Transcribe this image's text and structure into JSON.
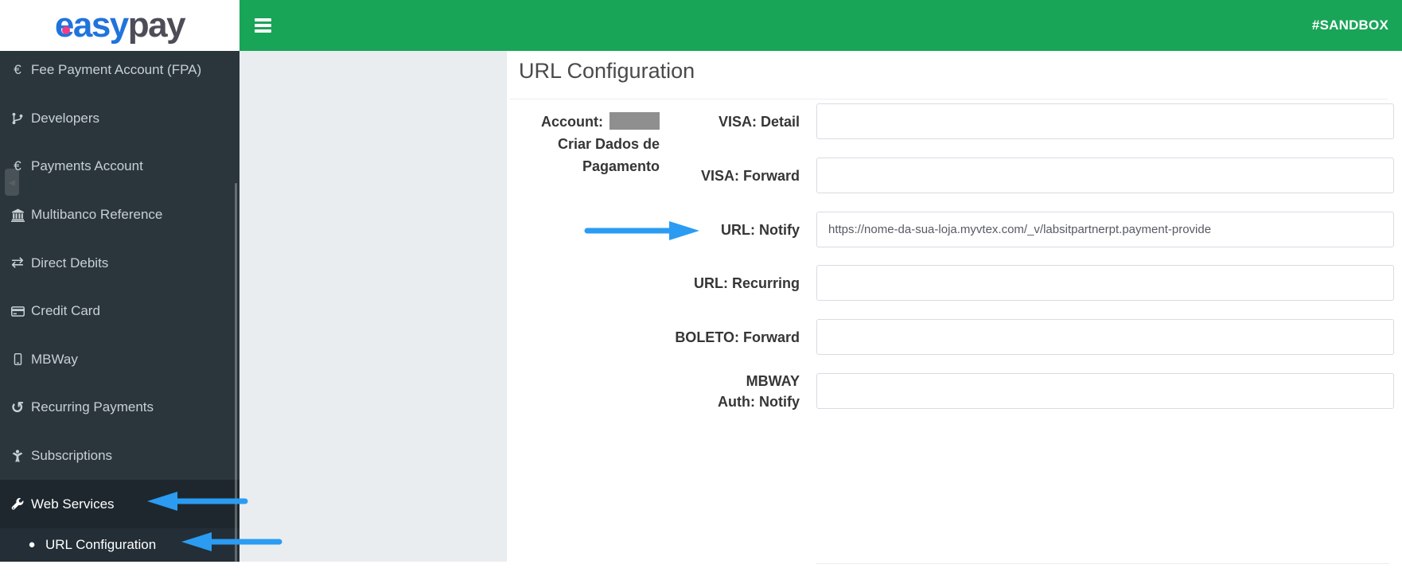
{
  "header": {
    "logo": {
      "text_primary": "easy",
      "text_secondary": "pay"
    },
    "sandbox_label": "#SANDBOX"
  },
  "icons": {
    "euro": "€",
    "exchange": "⇄",
    "history": "↺",
    "circle": "●",
    "triangle_left": "◀"
  },
  "sidebar": {
    "items": [
      {
        "icon": "euro-icon",
        "label": "Fee Payment Account (FPA)"
      },
      {
        "icon": "code-branch-icon",
        "label": "Developers"
      },
      {
        "icon": "euro-icon",
        "label": "Payments Account"
      },
      {
        "icon": "bank-icon",
        "label": "Multibanco Reference"
      },
      {
        "icon": "exchange-icon",
        "label": "Direct Debits"
      },
      {
        "icon": "credit-card-icon",
        "label": "Credit Card"
      },
      {
        "icon": "mobile-icon",
        "label": "MBWay"
      },
      {
        "icon": "history-icon",
        "label": "Recurring Payments"
      },
      {
        "icon": "person-icon",
        "label": "Subscriptions"
      },
      {
        "icon": "wrench-icon",
        "label": "Web Services",
        "active": true
      },
      {
        "icon": "circle-icon",
        "label": "URL Configuration",
        "active": true,
        "submenu": true
      }
    ]
  },
  "main": {
    "title": "URL Configuration",
    "account": {
      "label": "Account:",
      "line2": "Criar Dados de",
      "line3": "Pagamento"
    },
    "fields": [
      {
        "label": "VISA: Detail",
        "value": ""
      },
      {
        "label": "VISA: Forward",
        "value": ""
      },
      {
        "label": "URL: Notify",
        "value": "https://nome-da-sua-loja.myvtex.com/_v/labsitpartnerpt.payment-provide",
        "highlighted": true
      },
      {
        "label": "URL: Recurring",
        "value": ""
      },
      {
        "label": "BOLETO: Forward",
        "value": ""
      },
      {
        "label": "MBWAY\nAuth: Notify",
        "value": ""
      }
    ]
  },
  "colors": {
    "green": "#18a558",
    "sidebar": "#2b363c",
    "sidebar_active": "#1e272d",
    "sidebar_subactive": "#232e36",
    "accent_arrow": "#2b9cf2",
    "logo_blue": "#2173dc",
    "logo_gray": "#4d4d57",
    "logo_dot": "#f23b87",
    "panel_gray": "#e9edf0",
    "label_text": "#363636",
    "redacted": "#8f8f8f"
  }
}
